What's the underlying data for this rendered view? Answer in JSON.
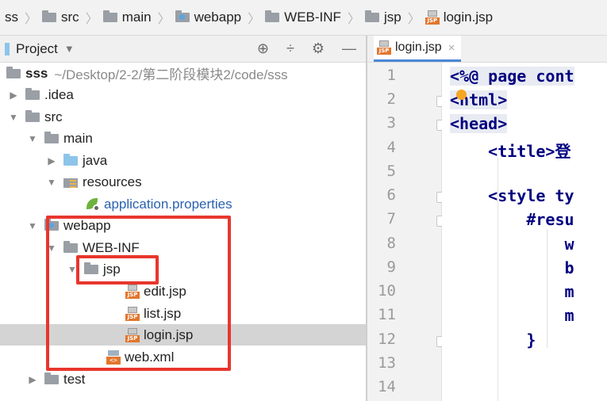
{
  "breadcrumb": [
    {
      "label": "ss",
      "icon": "none"
    },
    {
      "label": "src",
      "icon": "folder-icon"
    },
    {
      "label": "main",
      "icon": "folder-icon"
    },
    {
      "label": "webapp",
      "icon": "web-folder-icon"
    },
    {
      "label": "WEB-INF",
      "icon": "folder-icon"
    },
    {
      "label": "jsp",
      "icon": "folder-icon"
    },
    {
      "label": "login.jsp",
      "icon": "jsp-file-icon"
    }
  ],
  "project_panel": {
    "title": "Project",
    "dropdown_glyph": "▼",
    "tools": {
      "target": "⊕",
      "collapse": "÷",
      "settings": "⚙",
      "hide": "—"
    }
  },
  "tree": {
    "root_name": "sss",
    "root_path": "~/Desktop/2-2/第二阶段模块2/code/sss",
    "idea": ".idea",
    "src": "src",
    "main": "main",
    "java": "java",
    "resources": "resources",
    "app_props": "application.properties",
    "webapp": "webapp",
    "webinf": "WEB-INF",
    "jsp": "jsp",
    "edit": "edit.jsp",
    "list": "list.jsp",
    "login": "login.jsp",
    "webxml": "web.xml",
    "test": "test"
  },
  "editor": {
    "tab_label": "login.jsp",
    "tab_close": "×",
    "line_numbers": [
      "1",
      "2",
      "3",
      "4",
      "5",
      "6",
      "7",
      "8",
      "9",
      "10",
      "11",
      "12",
      "13",
      "14"
    ],
    "code_lines": [
      "<%@ page cont",
      "<html>",
      "<head>",
      "    <title>登",
      "",
      "    <style ty",
      "        #resu",
      "            w",
      "            b",
      "            m",
      "            m",
      "        }",
      "",
      "        "
    ]
  },
  "colors": {
    "highlight_box": "#e8362d",
    "selection": "#d4d4d4",
    "code_tag": "#000080"
  }
}
